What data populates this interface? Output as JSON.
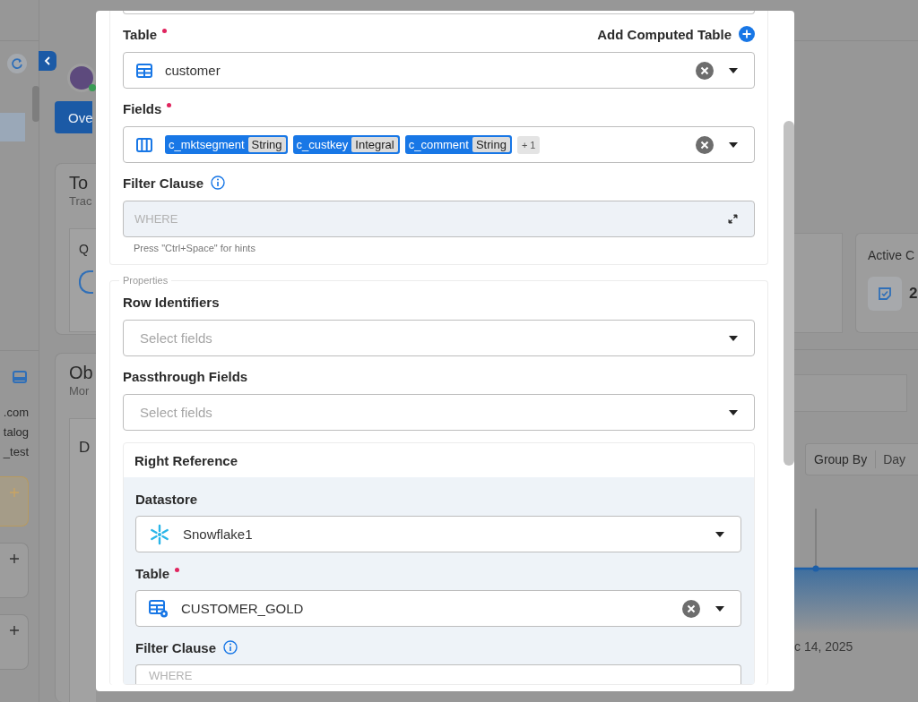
{
  "backdrop": {
    "sidebar_lines": [
      ".com",
      "talog",
      "_test"
    ],
    "overview_button": "Ove",
    "totals_card": {
      "title": "To",
      "subtitle": "Trac",
      "tile_label": "Q"
    },
    "observability_card": {
      "title": "Ob",
      "subtitle": "Mor",
      "panel_title": "D"
    },
    "active_card": {
      "label": "Active C",
      "value": "2"
    },
    "group_by": {
      "label": "Group By",
      "value": "Day"
    },
    "chart_date": "c 14, 2025"
  },
  "modal": {
    "table": {
      "label": "Table",
      "required": true,
      "action": "Add Computed Table",
      "value": "customer"
    },
    "fields": {
      "label": "Fields",
      "required": true,
      "tags": [
        {
          "name": "c_mktsegment",
          "type": "String"
        },
        {
          "name": "c_custkey",
          "type": "Integral"
        },
        {
          "name": "c_comment",
          "type": "String"
        }
      ],
      "more": "+ 1"
    },
    "filter": {
      "label": "Filter Clause",
      "placeholder": "WHERE",
      "hint": "Press \"Ctrl+Space\" for hints"
    },
    "properties": {
      "legend": "Properties",
      "row_identifiers": {
        "label": "Row Identifiers",
        "placeholder": "Select fields"
      },
      "passthrough_fields": {
        "label": "Passthrough Fields",
        "placeholder": "Select fields"
      },
      "right_reference": {
        "title": "Right Reference",
        "datastore": {
          "label": "Datastore",
          "value": "Snowflake1"
        },
        "table": {
          "label": "Table",
          "required": true,
          "value": "CUSTOMER_GOLD"
        },
        "filter": {
          "label": "Filter Clause",
          "placeholder": "WHERE"
        }
      }
    }
  }
}
